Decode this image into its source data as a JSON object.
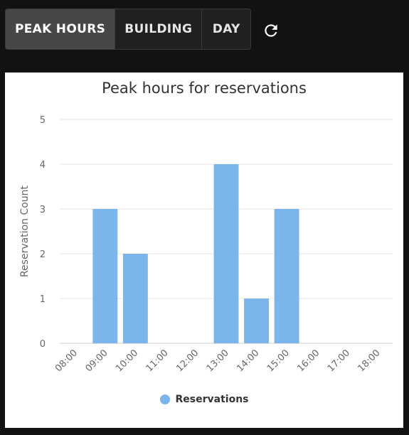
{
  "toolbar": {
    "tabs": [
      {
        "label": "PEAK HOURS",
        "active": true
      },
      {
        "label": "BUILDING",
        "active": false
      },
      {
        "label": "DAY",
        "active": false
      }
    ],
    "refresh_icon": "refresh-icon"
  },
  "colors": {
    "bar": "#7cb5ec",
    "grid": "#e6e6e6",
    "axis_text": "#666666",
    "active_tab": "#474747"
  },
  "chart_data": {
    "type": "bar",
    "title": "Peak hours for reservations",
    "xlabel": "",
    "ylabel": "Reservation Count",
    "categories": [
      "08:00",
      "09:00",
      "10:00",
      "11:00",
      "12:00",
      "13:00",
      "14:00",
      "15:00",
      "16:00",
      "17:00",
      "18:00"
    ],
    "series": [
      {
        "name": "Reservations",
        "values": [
          0,
          3,
          2,
          0,
          0,
          4,
          1,
          3,
          0,
          0,
          0
        ]
      }
    ],
    "ylim": [
      0,
      5
    ],
    "yticks": [
      "0",
      "1",
      "2",
      "3",
      "4",
      "5"
    ],
    "grid": true,
    "legend": "bottom-center"
  }
}
